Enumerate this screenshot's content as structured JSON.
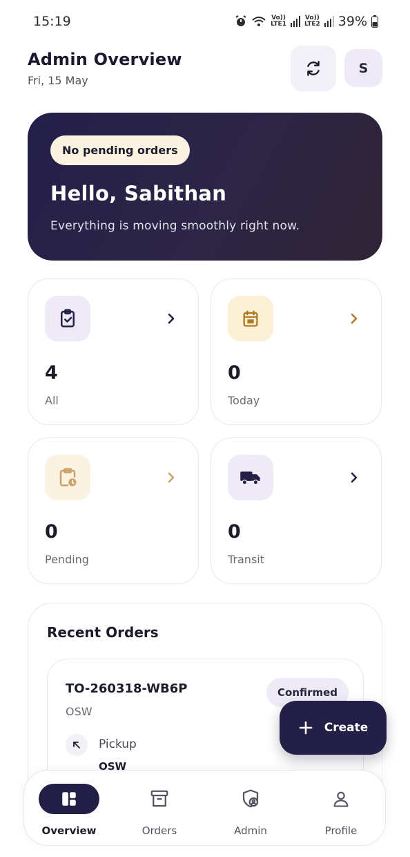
{
  "status_bar": {
    "time": "15:19",
    "net1_line1": "Vo))",
    "net1_line2": "LTE1",
    "net2_line1": "Vo))",
    "net2_line2": "LTE2",
    "battery": "39%"
  },
  "header": {
    "title": "Admin Overview",
    "date": "Fri, 15 May",
    "avatar_initial": "S",
    "refresh_icon": "refresh-icon"
  },
  "hero": {
    "badge": "No pending orders",
    "greeting": "Hello, Sabithan",
    "message": "Everything is moving smoothly right now."
  },
  "stats": [
    {
      "label": "All",
      "count": "4",
      "icon": "clipboard-check-icon",
      "icon_bg": "#eeebf6",
      "accent": "#231f46"
    },
    {
      "label": "Today",
      "count": "0",
      "icon": "calendar-icon",
      "icon_bg": "#fbf0d6",
      "accent": "#b07a23"
    },
    {
      "label": "Pending",
      "count": "0",
      "icon": "clipboard-clock-icon",
      "icon_bg": "#fbf3e2",
      "accent": "#c9a36a"
    },
    {
      "label": "Transit",
      "count": "0",
      "icon": "truck-icon",
      "icon_bg": "#eeebf6",
      "accent": "#231f46"
    }
  ],
  "recent_orders": {
    "title": "Recent Orders",
    "orders": [
      {
        "id": "TO-260318-WB6P",
        "sub": "OSW",
        "status": "Confirmed",
        "pickup_label": "Pickup",
        "pickup_value": "OSW"
      }
    ]
  },
  "fab": {
    "label": "Create"
  },
  "nav": [
    {
      "label": "Overview",
      "icon": "dashboard-icon",
      "active": true
    },
    {
      "label": "Orders",
      "icon": "archive-icon",
      "active": false
    },
    {
      "label": "Admin",
      "icon": "shield-user-icon",
      "active": false
    },
    {
      "label": "Profile",
      "icon": "user-icon",
      "active": false
    }
  ],
  "colors": {
    "primary": "#231f46",
    "cream": "#fbf3e2",
    "lavender": "#eeebf6"
  }
}
